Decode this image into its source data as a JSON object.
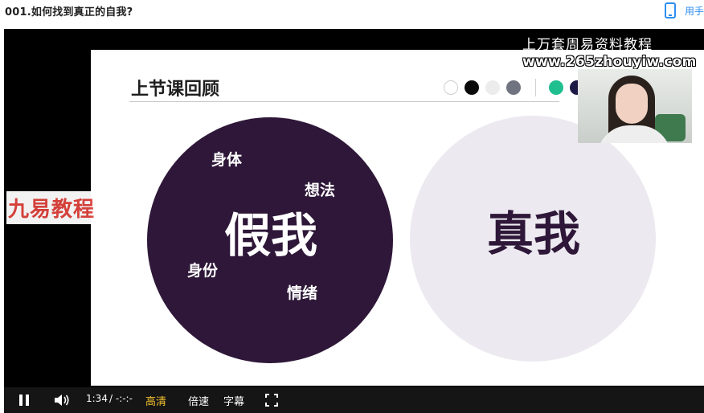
{
  "page": {
    "title": "001.如何找到真正的自我?",
    "app_label": "用手",
    "app_icon": "phone-icon"
  },
  "slide": {
    "heading": "上节课回顾",
    "dots": [
      "#ffffff",
      "#0a0a0a",
      "#ececec",
      "#6f7480",
      "#1fbf8f",
      "#1d1b46"
    ],
    "false_self": {
      "title": "假我",
      "words": [
        "身体",
        "想法",
        "身份",
        "情绪"
      ],
      "color": "#2e1738"
    },
    "true_self": {
      "title": "真我",
      "color": "#eceaf0"
    }
  },
  "overlay": {
    "watermark_cn": "上万套周易资料教程",
    "watermark_url": "www.265zhouyiw.com",
    "logo": "九易教程"
  },
  "controls": {
    "time_current": "1:34",
    "time_total": "/ -:-:-",
    "quality": "高清",
    "speed": "倍速",
    "subtitle": "字幕",
    "icons": [
      "pause-icon",
      "volume-icon",
      "fullscreen-icon"
    ]
  }
}
